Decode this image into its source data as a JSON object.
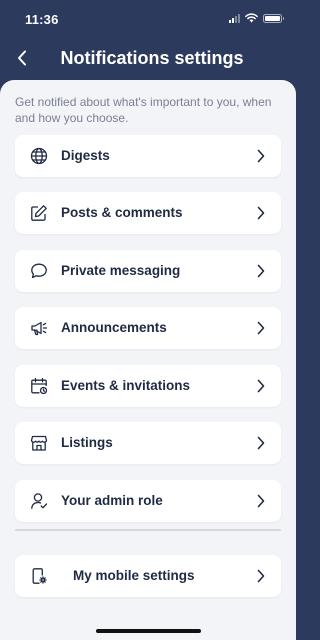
{
  "status_bar": {
    "time": "11:36"
  },
  "header": {
    "title": "Notifications settings"
  },
  "intro_text": "Get notified about what's important to you, when and how you choose.",
  "items": [
    {
      "label": "Digests",
      "icon": "globe-icon"
    },
    {
      "label": "Posts & comments",
      "icon": "edit-icon"
    },
    {
      "label": "Private messaging",
      "icon": "chat-icon"
    },
    {
      "label": "Announcements",
      "icon": "megaphone-icon"
    },
    {
      "label": "Events & invitations",
      "icon": "calendar-icon"
    },
    {
      "label": "Listings",
      "icon": "store-icon"
    },
    {
      "label": "Your admin role",
      "icon": "user-check-icon"
    }
  ],
  "mobile_settings": {
    "label": "My mobile settings",
    "icon": "phone-settings-icon"
  },
  "colors": {
    "header_bg": "#2c3a5d",
    "sheet_bg": "#f3f4f8",
    "text_dark": "#1f2a44",
    "text_muted": "#7a8094"
  }
}
